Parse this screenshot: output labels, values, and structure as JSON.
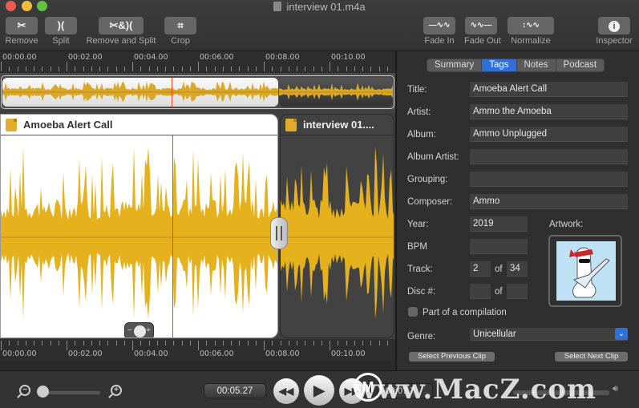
{
  "window": {
    "title": "interview 01.m4a",
    "traffic_lights": {
      "close": "#ee5a52",
      "minimize": "#f2bd3a",
      "maximize": "#5fc33e"
    }
  },
  "toolbar": {
    "remove": {
      "icon": "scissors-icon",
      "glyph": "✂",
      "label": "Remove"
    },
    "split": {
      "icon": "split-icon",
      "glyph": ")(",
      "label": "Split"
    },
    "remove_and_split": {
      "icon": "scissors-split-icon",
      "glyph": "✂&)(",
      "label": "Remove and Split"
    },
    "crop": {
      "icon": "crop-icon",
      "glyph": "⌗",
      "label": "Crop"
    },
    "fade_in": {
      "icon": "fade-in-icon",
      "glyph": "—∿∿",
      "label": "Fade In"
    },
    "fade_out": {
      "icon": "fade-out-icon",
      "glyph": "∿∿—",
      "label": "Fade Out"
    },
    "normalize": {
      "icon": "normalize-icon",
      "glyph": "↕∿∿",
      "label": "Normalize"
    },
    "inspector": {
      "icon": "info-icon",
      "glyph": "i",
      "label": "Inspector"
    }
  },
  "ruler": {
    "labels": [
      "00:00.00",
      "00:02.00",
      "00:04.00",
      "00:06.00",
      "00:08.00",
      "00:10.00"
    ]
  },
  "clips": [
    {
      "title": "Amoeba Alert Call",
      "selected": true,
      "icon": "aac-file-icon"
    },
    {
      "title": "interview 01....",
      "selected": false,
      "icon": "aac-file-icon"
    }
  ],
  "colors": {
    "waveform": "#e5b11c",
    "overview_waveform": "#d9a829",
    "playhead": "#e2452a",
    "accent": "#2f6fd6"
  },
  "playhead_time_seconds": 4.6,
  "inspector": {
    "tabs": [
      {
        "label": "Summary",
        "active": false
      },
      {
        "label": "Tags",
        "active": true
      },
      {
        "label": "Notes",
        "active": false
      },
      {
        "label": "Podcast",
        "active": false
      }
    ],
    "fields": {
      "title": {
        "label": "Title:",
        "value": "Amoeba Alert Call"
      },
      "artist": {
        "label": "Artist:",
        "value": "Ammo the Amoeba"
      },
      "album": {
        "label": "Album:",
        "value": "Ammo Unplugged"
      },
      "album_artist": {
        "label": "Album Artist:",
        "value": ""
      },
      "grouping": {
        "label": "Grouping:",
        "value": ""
      },
      "composer": {
        "label": "Composer:",
        "value": "Ammo"
      },
      "year": {
        "label": "Year:",
        "value": "2019"
      },
      "bpm": {
        "label": "BPM",
        "value": ""
      },
      "track": {
        "label": "Track:",
        "value": "2",
        "of_label": "of",
        "total": "34"
      },
      "disc": {
        "label": "Disc #:",
        "value": "",
        "of_label": "of",
        "total": ""
      },
      "genre": {
        "label": "Genre:",
        "value": "Unicellular"
      }
    },
    "artwork_label": "Artwork:",
    "compilation": {
      "label": "Part of a compilation",
      "checked": false
    },
    "select_previous": "Select Previous Clip",
    "select_next": "Select Next Clip"
  },
  "transport": {
    "current_time": "00:05.27",
    "remaining_time": "-00:07.7",
    "zoom_level": 0.05,
    "rewind_glyph": "◀◀",
    "play_glyph": "▶",
    "ff_glyph": "▶▶"
  },
  "watermark": {
    "text": "www.MacZ.com",
    "logo": "M"
  }
}
